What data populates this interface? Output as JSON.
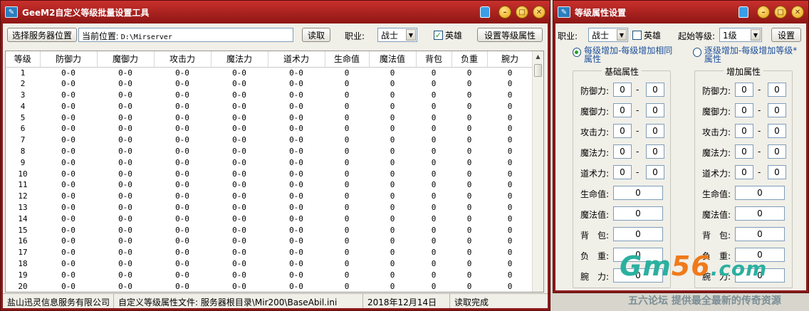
{
  "main": {
    "title": "GeeM2自定义等级批量设置工具",
    "toolbar": {
      "select_server_label": "选择服务器位置",
      "current_location_label": "当前位置:",
      "path_value": "D:\\Mirserver",
      "read_label": "读取",
      "job_label": "职业:",
      "job_value": "战士",
      "hero_label": "英雄",
      "hero_checked": "✓",
      "set_level_attr_label": "设置等级属性"
    },
    "columns": [
      "等级",
      "防御力",
      "魔御力",
      "攻击力",
      "魔法力",
      "道术力",
      "生命值",
      "魔法值",
      "背包",
      "负重",
      "腕力"
    ],
    "rows": [
      [
        "1",
        "0-0",
        "0-0",
        "0-0",
        "0-0",
        "0-0",
        "0",
        "0",
        "0",
        "0",
        "0"
      ],
      [
        "2",
        "0-0",
        "0-0",
        "0-0",
        "0-0",
        "0-0",
        "0",
        "0",
        "0",
        "0",
        "0"
      ],
      [
        "3",
        "0-0",
        "0-0",
        "0-0",
        "0-0",
        "0-0",
        "0",
        "0",
        "0",
        "0",
        "0"
      ],
      [
        "4",
        "0-0",
        "0-0",
        "0-0",
        "0-0",
        "0-0",
        "0",
        "0",
        "0",
        "0",
        "0"
      ],
      [
        "5",
        "0-0",
        "0-0",
        "0-0",
        "0-0",
        "0-0",
        "0",
        "0",
        "0",
        "0",
        "0"
      ],
      [
        "6",
        "0-0",
        "0-0",
        "0-0",
        "0-0",
        "0-0",
        "0",
        "0",
        "0",
        "0",
        "0"
      ],
      [
        "7",
        "0-0",
        "0-0",
        "0-0",
        "0-0",
        "0-0",
        "0",
        "0",
        "0",
        "0",
        "0"
      ],
      [
        "8",
        "0-0",
        "0-0",
        "0-0",
        "0-0",
        "0-0",
        "0",
        "0",
        "0",
        "0",
        "0"
      ],
      [
        "9",
        "0-0",
        "0-0",
        "0-0",
        "0-0",
        "0-0",
        "0",
        "0",
        "0",
        "0",
        "0"
      ],
      [
        "10",
        "0-0",
        "0-0",
        "0-0",
        "0-0",
        "0-0",
        "0",
        "0",
        "0",
        "0",
        "0"
      ],
      [
        "11",
        "0-0",
        "0-0",
        "0-0",
        "0-0",
        "0-0",
        "0",
        "0",
        "0",
        "0",
        "0"
      ],
      [
        "12",
        "0-0",
        "0-0",
        "0-0",
        "0-0",
        "0-0",
        "0",
        "0",
        "0",
        "0",
        "0"
      ],
      [
        "13",
        "0-0",
        "0-0",
        "0-0",
        "0-0",
        "0-0",
        "0",
        "0",
        "0",
        "0",
        "0"
      ],
      [
        "14",
        "0-0",
        "0-0",
        "0-0",
        "0-0",
        "0-0",
        "0",
        "0",
        "0",
        "0",
        "0"
      ],
      [
        "15",
        "0-0",
        "0-0",
        "0-0",
        "0-0",
        "0-0",
        "0",
        "0",
        "0",
        "0",
        "0"
      ],
      [
        "16",
        "0-0",
        "0-0",
        "0-0",
        "0-0",
        "0-0",
        "0",
        "0",
        "0",
        "0",
        "0"
      ],
      [
        "17",
        "0-0",
        "0-0",
        "0-0",
        "0-0",
        "0-0",
        "0",
        "0",
        "0",
        "0",
        "0"
      ],
      [
        "18",
        "0-0",
        "0-0",
        "0-0",
        "0-0",
        "0-0",
        "0",
        "0",
        "0",
        "0",
        "0"
      ],
      [
        "19",
        "0-0",
        "0-0",
        "0-0",
        "0-0",
        "0-0",
        "0",
        "0",
        "0",
        "0",
        "0"
      ],
      [
        "20",
        "0-0",
        "0-0",
        "0-0",
        "0-0",
        "0-0",
        "0",
        "0",
        "0",
        "0",
        "0"
      ]
    ],
    "status": {
      "company": "盐山迅灵信息服务有限公司",
      "file_label": "自定义等级属性文件: 服务器根目录\\Mir200\\BaseAbil.ini",
      "date": "2018年12月14日",
      "state": "读取完成"
    }
  },
  "sub": {
    "title": "等级属性设置",
    "job_label": "职业:",
    "job_value": "战士",
    "hero_label": "英雄",
    "start_level_label": "起始等级:",
    "start_level_value": "1级",
    "set_label": "设置",
    "radio1_label": "每级增加-每级增加相同属性",
    "radio2_label": "逐级增加-每级增加等级*属性",
    "base_group_title": "基础属性",
    "add_group_title": "增加属性",
    "dash": "-",
    "range_attrs": [
      "防御力:",
      "魔御力:",
      "攻击力:",
      "魔法力:",
      "道术力:"
    ],
    "single_attrs": [
      "生命值:",
      "魔法值:",
      "背　包:",
      "负　重:",
      "腕　力:"
    ],
    "zero": "0"
  },
  "watermark": {
    "logo_a": "Gm",
    "logo_b": "56",
    "logo_c": ".com",
    "slogan": "五六论坛 提供最全最新的传奇资源"
  },
  "colors": {
    "title_bar": "#b52522",
    "accent_green": "#21a121"
  },
  "icons": {
    "app": "app-logo-icon",
    "skin": "shirt-icon",
    "minimize": "minimize-icon",
    "maximize": "maximize-icon",
    "close": "close-icon"
  }
}
